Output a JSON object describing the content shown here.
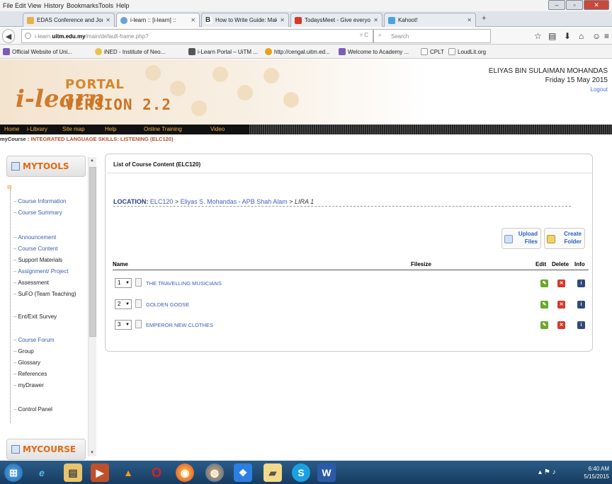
{
  "menubar": {
    "items": [
      "File",
      "Edit",
      "View",
      "History",
      "Bookmarks",
      "Tools",
      "Help"
    ]
  },
  "tabs": [
    {
      "label": "EDAS Conference and Jour...",
      "color": "#e8b04a"
    },
    {
      "label": "i-learn :: [i-learn] ::",
      "color": "#6ba3d6"
    },
    {
      "label": "How to Write Guide: Makin...",
      "color": "#333333"
    },
    {
      "label": "TodaysMeet - Give everyo...",
      "color": "#d43a2a"
    },
    {
      "label": "Kahoot!",
      "color": "#4aa3df"
    }
  ],
  "navbar": {
    "url_host": "i-learn.uitm.edu.my",
    "url_prefix": "i-learn.",
    "url_domain": "uitm.edu.my",
    "url_path": "/main/default-frame.php?",
    "search_placeholder": "Search"
  },
  "bookmarks": [
    "Official Website of Uni...",
    "iNED - Institute of Neo...",
    "i-Learn Portal – UiTM ...",
    "http://cengal.uitm.ed...",
    "Welcome to Academy ...",
    "CPLT",
    "LoudLit.org"
  ],
  "header": {
    "logo_ilearn": "i-learn",
    "logo_portal": "PORTAL",
    "logo_version": "VERSION 2.2",
    "user_name": "ELIYAS BIN SULAIMAN MOHANDAS",
    "date": "Friday 15 May 2015",
    "logout": "Logout"
  },
  "mainnav": [
    "Home",
    "i-Library",
    "Site map",
    "Help",
    "Online Training",
    "Video"
  ],
  "breadcrumb": {
    "prefix": "myCourse : ",
    "course": "INTEGRATED LANGUAGE SKILLS: LISTENING (ELC120)"
  },
  "sidebar": {
    "mytools": "MYTOOLS",
    "mycourse": "MYCOURSE",
    "items": [
      {
        "label": "Course Information",
        "link": true
      },
      {
        "label": "Course Summary",
        "link": true
      },
      {
        "label": "Announcement",
        "link": true
      },
      {
        "label": "Course Content",
        "link": true
      },
      {
        "label": "Support Materials",
        "link": false
      },
      {
        "label": "Assignment/ Project",
        "link": true
      },
      {
        "label": "Assessment",
        "link": false
      },
      {
        "label": "SuFO (Team Teaching)",
        "link": false
      },
      {
        "label": "Ent/Exit Survey",
        "link": false
      },
      {
        "label": "Course Forum",
        "link": true
      },
      {
        "label": "Group",
        "link": false
      },
      {
        "label": "Glossary",
        "link": false
      },
      {
        "label": "References",
        "link": false
      },
      {
        "label": "myDrawer",
        "link": false
      },
      {
        "label": "Control Panel",
        "link": false
      }
    ]
  },
  "content": {
    "title": "List of Course Content (ELC120)",
    "location_label": "LOCATION:",
    "location_code": "ELC120",
    "location_sep1": " > ",
    "location_owner": "Eliyas S. Mohandas - APB Shah Alam",
    "location_sep2": " > ",
    "location_current": "LIRA 1",
    "upload_label_1": "Upload",
    "upload_label_2": "Files",
    "create_label_1": "Create",
    "create_label_2": "Folder",
    "columns": {
      "name": "Name",
      "filesize": "Filesize",
      "edit": "Edit",
      "delete": "Delete",
      "info": "Info"
    },
    "rows": [
      {
        "order": "1",
        "name": "THE TRAVELLING MUSICIANS",
        "filesize": ""
      },
      {
        "order": "2",
        "name": "GOLDEN GOOSE",
        "filesize": ""
      },
      {
        "order": "3",
        "name": "EMPEROR NEW CLOTHES",
        "filesize": ""
      }
    ]
  },
  "taskbar": {
    "time": "6:40 AM",
    "date": "5/15/2015"
  }
}
